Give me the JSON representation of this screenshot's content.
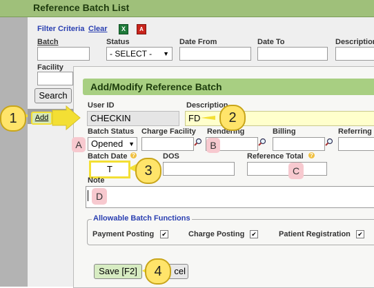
{
  "bg": {
    "title": "Reference Batch List",
    "filter_criteria": "Filter Criteria",
    "clear": "Clear",
    "col_batch": "Batch",
    "col_status": "Status",
    "col_date_from": "Date From",
    "col_date_to": "Date To",
    "col_description": "Description",
    "status_value": "- SELECT -",
    "facility": "Facility",
    "search_btn": "Search",
    "add_btn": "Add"
  },
  "dialog": {
    "title": "Add/Modify Reference Batch",
    "user_id_label": "User ID",
    "user_id_value": "CHECKIN",
    "description_label": "Description",
    "description_value": "FD",
    "batch_status_label": "Batch Status",
    "batch_status_value": "Opened",
    "charge_facility_label": "Charge Facility",
    "rendering_label": "Rendering",
    "billing_label": "Billing",
    "referring_label": "Referring",
    "batch_date_label": "Batch Date",
    "batch_date_value": "T",
    "dos_label": "DOS",
    "reference_total_label": "Reference Total",
    "note_label": "Note",
    "functions_legend": "Allowable Batch Functions",
    "payment_posting": "Payment Posting",
    "charge_posting": "Charge Posting",
    "patient_registration": "Patient Registration",
    "save_btn": "Save [F2]",
    "cancel_partial": "cel"
  },
  "callouts": {
    "n1": "1",
    "n2": "2",
    "n3": "3",
    "n4": "4",
    "a": "A",
    "b": "B",
    "c": "C",
    "d": "D"
  },
  "colors": {
    "header_green": "#a8cf82",
    "callout_yellow": "#ffe46a",
    "callout_pink": "#f7c9cf"
  },
  "icons": [
    "excel-icon",
    "pdf-icon",
    "magnifier-icon",
    "help-icon",
    "checkbox-icon",
    "dropdown-arrow-icon"
  ]
}
